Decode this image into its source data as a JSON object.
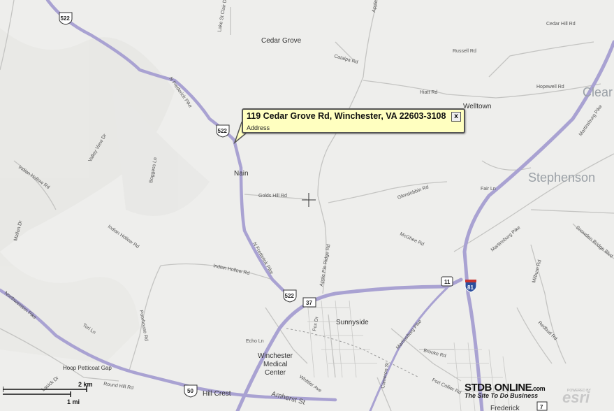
{
  "popup": {
    "address": "119 Cedar Grove Rd, Winchester, VA 22603-3108",
    "subtitle": "Address",
    "close_label": "x"
  },
  "places": {
    "cedar_grove": "Cedar Grove",
    "welltown": "Welltown",
    "nain": "Nain",
    "sunnyside": "Sunnyside",
    "winchester_medical_1": "Winchester",
    "winchester_medical_2": "Medical",
    "winchester_medical_3": "Center",
    "hoop_petticoat_gap": "Hoop Petticoat Gap",
    "hill_crest": "Hill Crest",
    "frederick": "Frederick",
    "stephenson": "Stephenson",
    "clear": "Clear"
  },
  "roads": {
    "n_frederick_pike_1": "N Frederick Pike",
    "n_frederick_pike_2": "N Frederick Pike",
    "cedar_hill": "Cedar Hill Rd",
    "russell": "Russell Rd",
    "catalpa": "Catalpa Rd",
    "hiatt": "Hiatt Rd",
    "hopewell": "Hopewell Rd",
    "golds_hill": "Golds Hill Rd",
    "glendobbin": "Glendobbin Rd",
    "fair": "Fair Ln",
    "martinsburg_pike_1": "Martinsburg Pike",
    "martinsburg_pike_2": "Martinsburg Pike",
    "martinsburg_pike_3": "Martinsburg Pike",
    "indian_hollow_1": "Indian Hollow Rd",
    "indian_hollow_2": "Indian Hollow Rd",
    "valley_view": "Valley View Dr",
    "boggess": "Boggess Ln",
    "indian_hollow_w": "Indian Hollow Rd",
    "mallon": "Mallon Dr",
    "lake_st_clair": "Lake St Clair Dr",
    "apple_pie_ridge": "Apple Pie Ridge Rd",
    "apple_top": "Apple",
    "mcghee": "McGhee Rd",
    "milburn": "Milburn Rd",
    "snowden": "Snowden Bridge Blvd",
    "redbud": "Redbud Rd",
    "brooke": "Brooke Rd",
    "fort_collier": "Fort Collier Rd",
    "northwestern_pike": "Northwestern Pike",
    "round_hill": "Round Hill Rd",
    "amherst": "Amherst St",
    "whittier": "Whittier Ave",
    "echo": "Echo Ln",
    "fox": "Fox Dr",
    "tori": "Tori Ln",
    "lasick": "Lasick Dr",
    "poorhouse": "Poorhouse Rd",
    "cameron": "Cameron St"
  },
  "shields": {
    "us522_a": "522",
    "us522_b": "522",
    "us522_c": "522",
    "va37": "37",
    "va11": "11",
    "i81": "81",
    "us50": "50",
    "va7": "7"
  },
  "scale_bar": {
    "km_label": "2 km",
    "mi_label": "1 mi"
  },
  "branding": {
    "stdb": "STDB ONLINE",
    "stdb_com": ".com",
    "stdb_tagline": "The Site To Do Business",
    "esri": "esri",
    "powered_by": "POWERED BY"
  },
  "colors": {
    "highway": "#a9a2d2",
    "road": "#bdbdbd",
    "land": "#eeeeec",
    "popup": "#ffffc0"
  }
}
